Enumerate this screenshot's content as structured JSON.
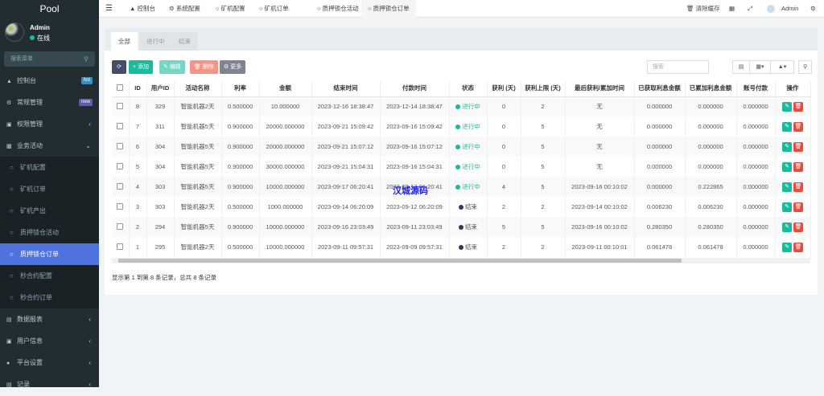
{
  "app": {
    "logo": "Pool",
    "user": "Admin",
    "status": "在线",
    "search_placeholder": "搜索菜单"
  },
  "sidebar": {
    "items": [
      {
        "label": "控制台",
        "icon": "dashboard-icon",
        "badge": "hot",
        "badge_color": "#3c8dbc"
      },
      {
        "label": "常规管理",
        "icon": "cogs-icon",
        "badge": "new",
        "badge_color": "#605ca8"
      },
      {
        "label": "权限管理",
        "icon": "group-icon"
      },
      {
        "label": "业务活动",
        "icon": "list-icon"
      }
    ],
    "sub": [
      "矿机配置",
      "矿机订单",
      "矿机产出",
      "质押锁仓活动",
      "质押锁仓订单",
      "秒合约配置",
      "秒合约订单"
    ],
    "bottom": [
      {
        "label": "数据报表",
        "icon": "file-icon"
      },
      {
        "label": "用户信息",
        "icon": "user-icon"
      },
      {
        "label": "平台设置",
        "icon": "settings-icon"
      },
      {
        "label": "记录",
        "icon": "chart-icon"
      }
    ]
  },
  "topbar": {
    "tabs": [
      "控制台",
      "系统配置",
      "矿机配置",
      "矿机订单",
      "质押锁仓活动",
      "质押锁仓订单"
    ],
    "clear_cache": "清除缓存",
    "admin": "Admin"
  },
  "panel": {
    "tabs": [
      "全部",
      "进行中",
      "结束"
    ],
    "buttons": {
      "add": "添加",
      "edit": "编辑",
      "delete": "删除",
      "more": "更多"
    },
    "search_placeholder": "搜索"
  },
  "table": {
    "headers": [
      "ID",
      "用户ID",
      "活动名称",
      "利率",
      "金额",
      "结束时间",
      "付款时间",
      "状态",
      "获利 (天)",
      "获利上限 (天)",
      "最后获利/累加时间",
      "已获取利息金额",
      "已累加利息金额",
      "账号付款",
      "操作"
    ],
    "rows": [
      [
        "8",
        "329",
        "智能机器2天",
        "0.500000",
        "10.000000",
        "2023-12-16 18:38:47",
        "2023-12-14 18:38:47",
        "进行中",
        "0",
        "2",
        "无",
        "0.000000",
        "0.000000",
        "0.000000"
      ],
      [
        "7",
        "311",
        "智能机器5天",
        "0.900000",
        "20000.000000",
        "2023-09-21 15:09:42",
        "2023-09-16 15:09:42",
        "进行中",
        "0",
        "5",
        "无",
        "0.000000",
        "0.000000",
        "0.000000"
      ],
      [
        "6",
        "304",
        "智能机器5天",
        "0.900000",
        "20000.000000",
        "2023-09-21 15:07:12",
        "2023-09-16 15:07:12",
        "进行中",
        "0",
        "5",
        "无",
        "0.000000",
        "0.000000",
        "0.000000"
      ],
      [
        "5",
        "304",
        "智能机器5天",
        "0.900000",
        "30000.000000",
        "2023-09-21 15:04:31",
        "2023-09-16 15:04:31",
        "进行中",
        "0",
        "5",
        "无",
        "0.000000",
        "0.000000",
        "0.000000"
      ],
      [
        "4",
        "303",
        "智能机器5天",
        "0.900000",
        "10000.000000",
        "2023-09-17 06:20:41",
        "2023-09-12 06:20:41",
        "进行中",
        "4",
        "5",
        "2023-09-16 00:10:02",
        "0.000000",
        "0.222865",
        "0.000000"
      ],
      [
        "3",
        "303",
        "智能机器2天",
        "0.500000",
        "1000.000000",
        "2023-09-14 06:20:09",
        "2023-09-12 06:20:09",
        "结束",
        "2",
        "2",
        "2023-09-14 00:10:02",
        "0.006230",
        "0.006230",
        "0.000000"
      ],
      [
        "2",
        "294",
        "智能机器5天",
        "0.900000",
        "10000.000000",
        "2023-09-16 23:03:49",
        "2023-09-11 23:03:49",
        "结束",
        "5",
        "5",
        "2023-09-16 00:10:02",
        "0.280350",
        "0.280350",
        "0.000000"
      ],
      [
        "1",
        "295",
        "智能机器2天",
        "0.500000",
        "10000.000000",
        "2023-09-11 09:57:31",
        "2023-09-09 09:57:31",
        "结束",
        "2",
        "2",
        "2023-09-11 00:10:01",
        "0.061478",
        "0.061478",
        "0.000000"
      ]
    ]
  },
  "footer": "显示第 1 到第 8 条记录，总共 8 条记录",
  "watermark": "汉城源码",
  "colors": {
    "running": "#18bc9c",
    "ended": "#2c3e50",
    "active_menu": "#4e73df"
  }
}
